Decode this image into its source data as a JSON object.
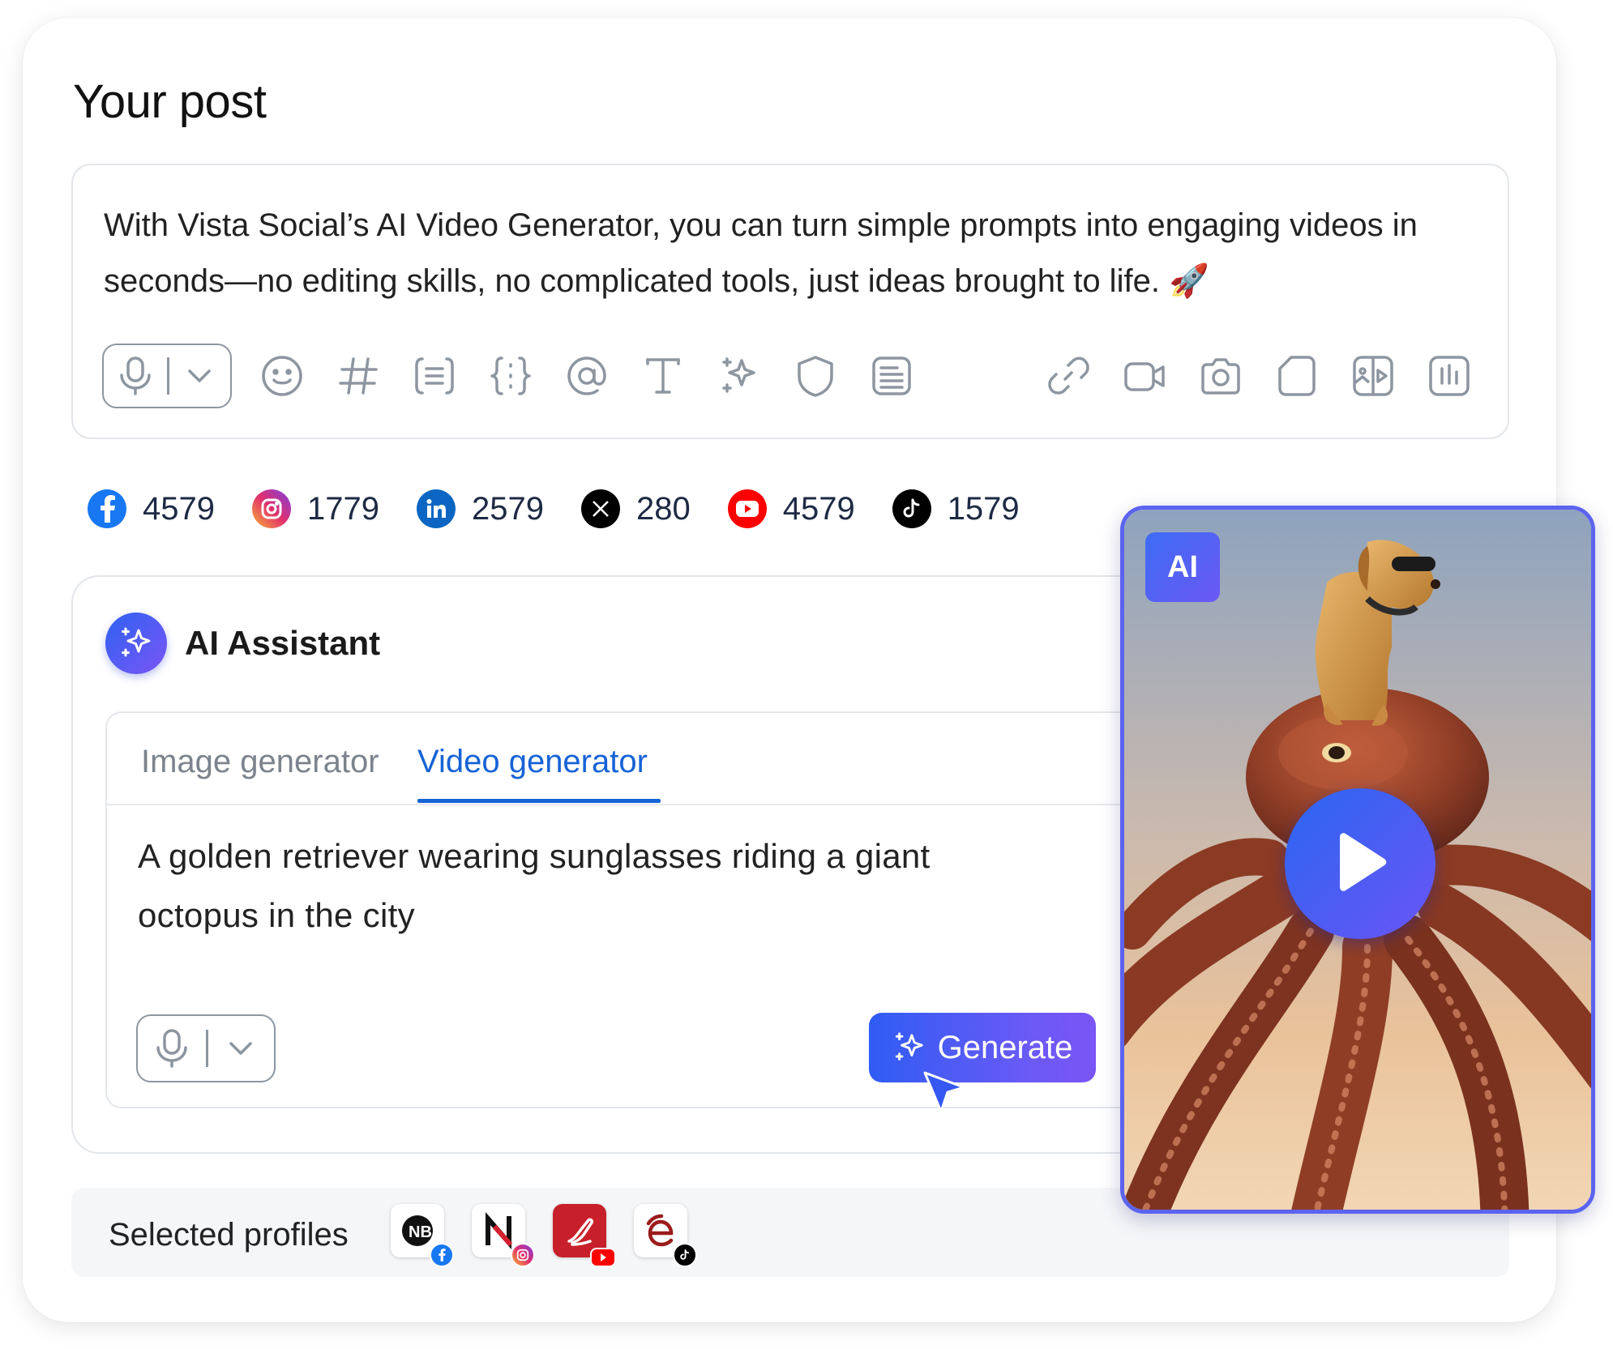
{
  "page_title": "Your post",
  "post": {
    "text": "With Vista Social’s AI Video Generator, you can turn simple prompts into engaging videos in seconds—no editing skills, no complicated tools, just ideas brought to life. 🚀",
    "toolbar_icons_left": [
      "emoji-icon",
      "hashtag-icon",
      "snippet-icon",
      "variables-icon",
      "mention-icon",
      "text-format-icon",
      "ai-sparkle-icon",
      "shield-icon",
      "template-icon"
    ],
    "toolbar_icons_right": [
      "link-icon",
      "video-icon",
      "camera-icon",
      "document-icon",
      "gallery-icon",
      "poll-icon"
    ]
  },
  "network_counts": [
    {
      "network": "facebook",
      "value": "4579",
      "color": "#1877f2"
    },
    {
      "network": "instagram",
      "value": "1779",
      "color": "#e1306c"
    },
    {
      "network": "linkedin",
      "value": "2579",
      "color": "#0a66c2"
    },
    {
      "network": "x",
      "value": "280",
      "color": "#000000"
    },
    {
      "network": "youtube",
      "value": "4579",
      "color": "#ff0000"
    },
    {
      "network": "tiktok",
      "value": "1579",
      "color": "#000000"
    }
  ],
  "ai_assistant": {
    "title": "AI Assistant",
    "tabs": [
      {
        "label": "Image generator",
        "active": false
      },
      {
        "label": "Video generator",
        "active": true
      }
    ],
    "prompt": "A golden retriever wearing sunglasses riding a giant octopus in the city",
    "generate_label": "Generate"
  },
  "profiles": {
    "label": "Selected profiles",
    "items": [
      {
        "name": "profile-nb",
        "network": "facebook"
      },
      {
        "name": "profile-n",
        "network": "instagram"
      },
      {
        "name": "profile-pen",
        "network": "youtube"
      },
      {
        "name": "profile-e",
        "network": "tiktok"
      }
    ]
  },
  "video_preview": {
    "badge": "AI"
  },
  "colors": {
    "accent_blue": "#1763d6",
    "gradient_start": "#2f5cf3",
    "gradient_end": "#7a55f6",
    "border": "#e3e6ea"
  }
}
